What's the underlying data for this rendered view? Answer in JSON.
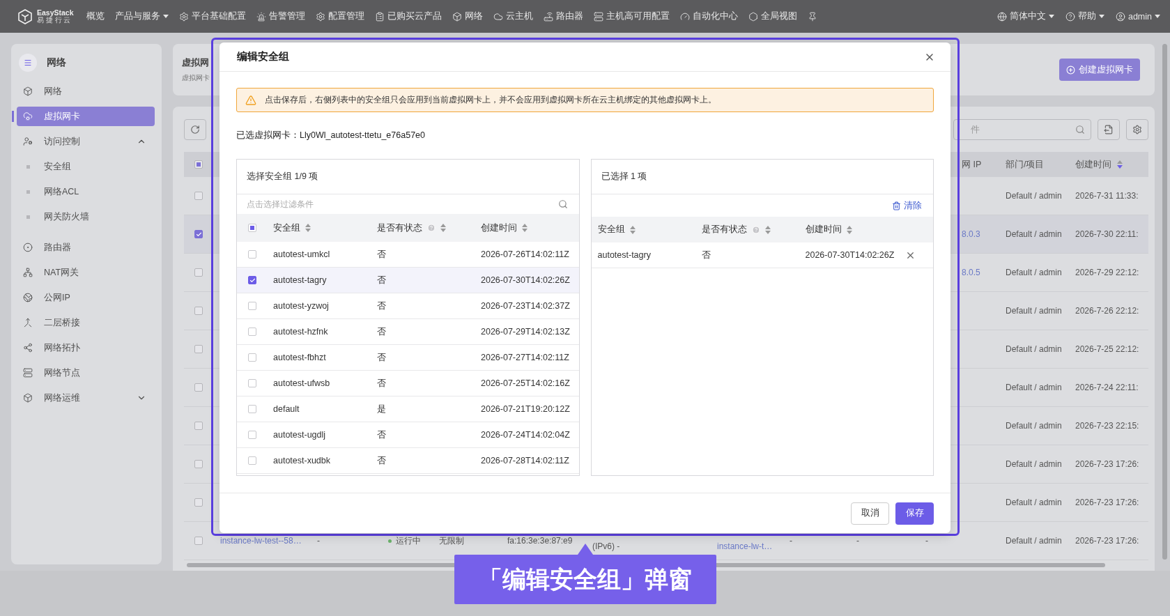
{
  "top_nav": {
    "logo": {
      "name": "EasyStack",
      "tagline": "易 捷 行 云"
    },
    "items": [
      {
        "label": "概览",
        "dropdown": false
      },
      {
        "label": "产品与服务",
        "dropdown": true
      },
      {
        "label": "平台基础配置",
        "dropdown": false
      },
      {
        "label": "告警管理",
        "dropdown": false
      },
      {
        "label": "配置管理",
        "dropdown": false
      },
      {
        "label": "已购买云产品",
        "dropdown": false
      },
      {
        "label": "网络",
        "dropdown": false
      },
      {
        "label": "云主机",
        "dropdown": false
      },
      {
        "label": "路由器",
        "dropdown": false
      },
      {
        "label": "主机高可用配置",
        "dropdown": false
      },
      {
        "label": "自动化中心",
        "dropdown": false
      },
      {
        "label": "全局视图",
        "dropdown": false
      }
    ],
    "right": [
      {
        "label": "简体中文",
        "dropdown": true
      },
      {
        "label": "帮助",
        "dropdown": true
      },
      {
        "label": "admin",
        "dropdown": true
      }
    ]
  },
  "sidebar": {
    "title": "网络",
    "items": [
      {
        "label": "网络",
        "selected": false
      },
      {
        "label": "虚拟网卡",
        "selected": true
      },
      {
        "label": "访问控制",
        "selected": false,
        "expanded": true,
        "children": [
          {
            "label": "安全组",
            "selected": false
          },
          {
            "label": "网络ACL",
            "selected": false
          },
          {
            "label": "网关防火墙",
            "selected": false
          }
        ]
      },
      {
        "label": "路由器",
        "selected": false
      },
      {
        "label": "NAT网关",
        "selected": false
      },
      {
        "label": "公网IP",
        "selected": false
      },
      {
        "label": "二层桥接",
        "selected": false
      },
      {
        "label": "网络拓扑",
        "selected": false
      },
      {
        "label": "网络节点",
        "selected": false
      },
      {
        "label": "网络运维",
        "selected": false,
        "expanded": false
      }
    ]
  },
  "page_header": {
    "title": "虚拟网",
    "subtitle": "虚拟网卡",
    "create_button": "创建虚拟网卡"
  },
  "table": {
    "search_placeholder": "件",
    "header_checkbox": {
      "checked": false,
      "indeterminate": true
    },
    "columns": [
      {
        "label": "网 IP"
      },
      {
        "label": "部门/项目"
      },
      {
        "label": "创建时间",
        "sorted_descending": true
      }
    ],
    "rows": [
      {
        "selected": false,
        "department": "Default / admin",
        "created": "2026-7-31 11:33:"
      },
      {
        "selected": true,
        "ip": "8.0.3",
        "department": "Default / admin",
        "created": "2026-7-30 22:11:"
      },
      {
        "selected": false,
        "ip": "8.0.5",
        "department": "Default / admin",
        "created": "2026-7-29 22:12:"
      },
      {
        "selected": false,
        "department": "Default / admin",
        "created": "2026-7-26 22:12:"
      },
      {
        "selected": false,
        "department": "Default / admin",
        "created": "2026-7-25 22:12:"
      },
      {
        "selected": false,
        "department": "Default / admin",
        "created": "2026-7-24 22:11:"
      },
      {
        "selected": false,
        "department": "Default / admin",
        "created": "2026-7-23 22:15:"
      },
      {
        "selected": false,
        "department": "Default / admin",
        "created": "2026-7-23 17:26:"
      },
      {
        "selected": false,
        "department": "Default / admin",
        "created": "2026-7-23 17:26:"
      },
      {
        "selected": false,
        "name": "instance-lw-test--58…",
        "column_3": "-",
        "status": "运行中",
        "column_5": "无限制",
        "mac": "fa:16:3e:3e:87:e9",
        "ipv6": "(IPv6) -",
        "attached": "instance-lw-t…",
        "column_9": "-",
        "column_10": "-",
        "column_11": "-",
        "department": "Default / admin",
        "created": "2026-7-23 17:26:"
      }
    ]
  },
  "dialog": {
    "title": "编辑安全组",
    "warning": "点击保存后，右侧列表中的安全组只会应用到当前虚拟网卡上，并不会应用到虚拟网卡所在云主机绑定的其他虚拟网卡上。",
    "selected_nic": "已选虚拟网卡：Lly0Wl_autotest-ttetu_e76a57e0",
    "source": {
      "title": "选择安全组 1/9 项",
      "filter_placeholder": "点击选择过滤条件",
      "header_checkbox": {
        "checked": false,
        "indeterminate": true
      },
      "columns": [
        {
          "label": "安全组",
          "help": false
        },
        {
          "label": "是否有状态",
          "help": true
        },
        {
          "label": "创建时间",
          "help": false
        }
      ],
      "rows": [
        {
          "checked": false,
          "name": "autotest-umkcl",
          "stateful": "否",
          "created": "2026-07-26T14:02:11Z"
        },
        {
          "checked": true,
          "name": "autotest-tagry",
          "stateful": "否",
          "created": "2026-07-30T14:02:26Z"
        },
        {
          "checked": false,
          "name": "autotest-yzwoj",
          "stateful": "否",
          "created": "2026-07-23T14:02:37Z"
        },
        {
          "checked": false,
          "name": "autotest-hzfnk",
          "stateful": "否",
          "created": "2026-07-29T14:02:13Z"
        },
        {
          "checked": false,
          "name": "autotest-fbhzt",
          "stateful": "否",
          "created": "2026-07-27T14:02:11Z"
        },
        {
          "checked": false,
          "name": "autotest-ufwsb",
          "stateful": "否",
          "created": "2026-07-25T14:02:16Z"
        },
        {
          "checked": false,
          "name": "default",
          "stateful": "是",
          "created": "2026-07-21T19:20:12Z"
        },
        {
          "checked": false,
          "name": "autotest-ugdlj",
          "stateful": "否",
          "created": "2026-07-24T14:02:04Z"
        },
        {
          "checked": false,
          "name": "autotest-xudbk",
          "stateful": "否",
          "created": "2026-07-28T14:02:11Z"
        }
      ]
    },
    "target": {
      "title": "已选择 1 项",
      "clear": "清除",
      "columns": [
        {
          "label": "安全组",
          "help": false
        },
        {
          "label": "是否有状态",
          "help": true
        },
        {
          "label": "创建时间",
          "help": false
        }
      ],
      "rows": [
        {
          "name": "autotest-tagry",
          "stateful": "否",
          "created": "2026-07-30T14:02:26Z"
        }
      ]
    },
    "buttons": [
      {
        "label": "取消",
        "primary": false
      },
      {
        "label": "保存",
        "primary": true
      }
    ]
  },
  "callout": "「编辑安全组」弹窗"
}
